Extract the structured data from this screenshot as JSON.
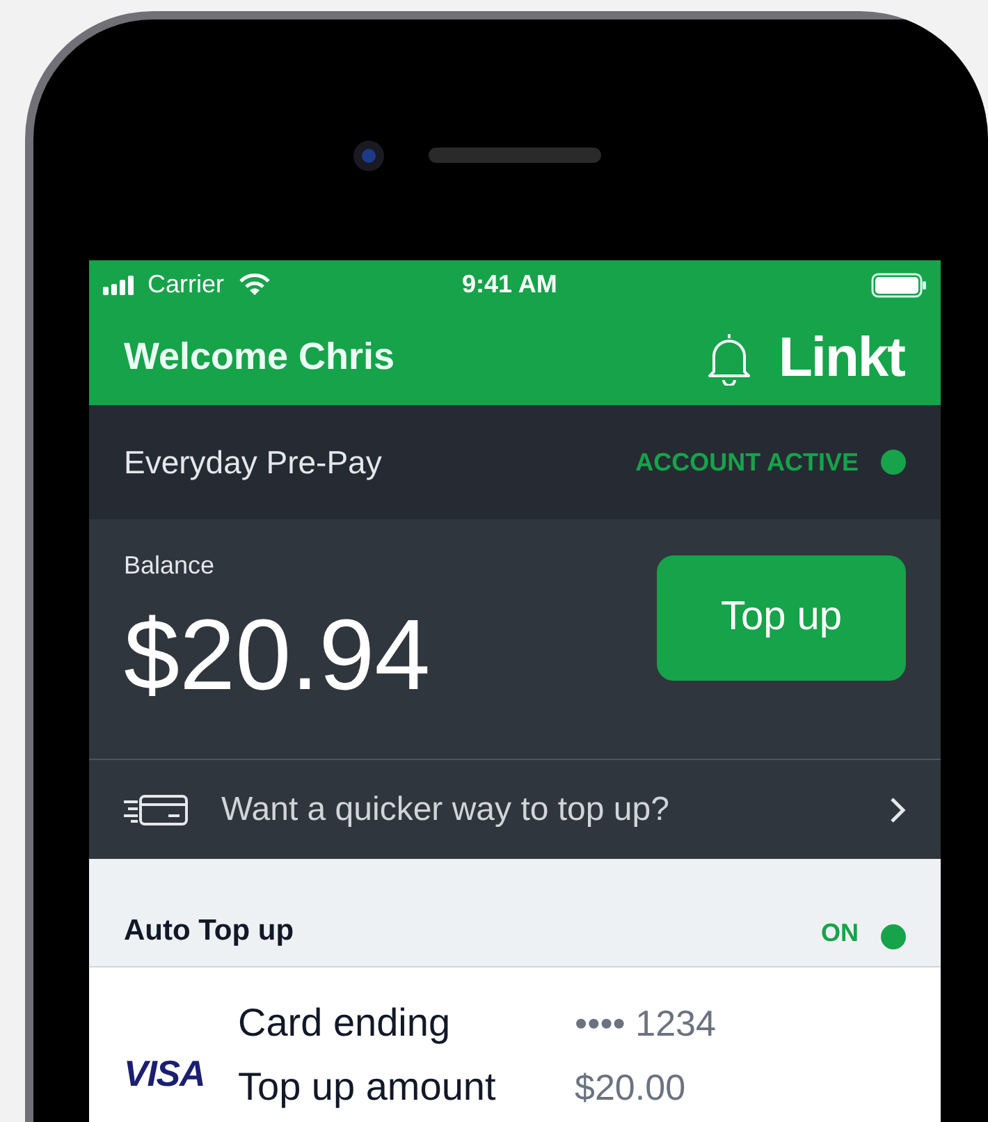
{
  "status_bar": {
    "carrier": "Carrier",
    "time": "9:41 AM"
  },
  "header": {
    "greeting": "Welcome Chris",
    "logo": "Linkt"
  },
  "account": {
    "name": "Everyday Pre-Pay",
    "status": "ACCOUNT ACTIVE",
    "active": true
  },
  "balance": {
    "label": "Balance",
    "amount": "$20.94",
    "button": "Top up"
  },
  "promo": {
    "text": "Want a quicker way to top up?"
  },
  "auto_top_up": {
    "label": "Auto Top up",
    "status": "ON",
    "on": true
  },
  "card": {
    "brand": "VISA",
    "rows": [
      {
        "label": "Card ending",
        "value": "•••• 1234"
      },
      {
        "label": "Top up amount",
        "value": "$20.00"
      }
    ]
  }
}
